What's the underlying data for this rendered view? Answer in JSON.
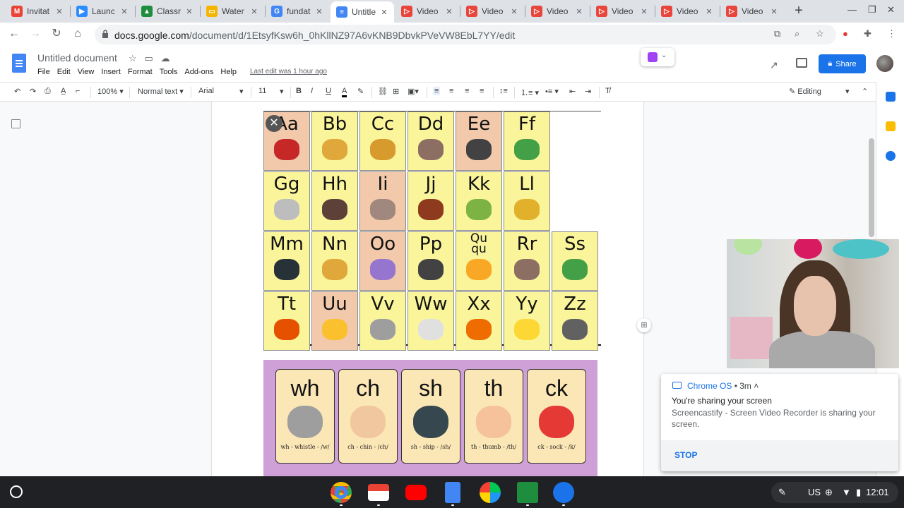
{
  "tabs": [
    {
      "label": "Invitat",
      "icon": "gmail-icon",
      "color": "#ea4335",
      "glyph": "M"
    },
    {
      "label": "Launc",
      "icon": "zoom-icon",
      "color": "#2d8cff",
      "glyph": "▶"
    },
    {
      "label": "Classr",
      "icon": "classroom-icon",
      "color": "#1e8e3e",
      "glyph": "▲"
    },
    {
      "label": "Water",
      "icon": "slides-icon",
      "color": "#f4b400",
      "glyph": "▭"
    },
    {
      "label": "fundat",
      "icon": "google-icon",
      "color": "#4285f4",
      "glyph": "G"
    },
    {
      "label": "Untitle",
      "icon": "docs-icon",
      "color": "#4285f4",
      "glyph": "≡"
    },
    {
      "label": "Video",
      "icon": "screencastify-icon",
      "color": "#e8453c",
      "glyph": "▷"
    },
    {
      "label": "Video",
      "icon": "screencastify-icon",
      "color": "#e8453c",
      "glyph": "▷"
    },
    {
      "label": "Video",
      "icon": "screencastify-icon",
      "color": "#e8453c",
      "glyph": "▷"
    },
    {
      "label": "Video",
      "icon": "screencastify-icon",
      "color": "#e8453c",
      "glyph": "▷"
    },
    {
      "label": "Video",
      "icon": "screencastify-icon",
      "color": "#e8453c",
      "glyph": "▷"
    },
    {
      "label": "Video",
      "icon": "screencastify-icon",
      "color": "#e8453c",
      "glyph": "▷"
    }
  ],
  "omnibox": {
    "domain": "docs.google.com",
    "path": "/document/d/1EtsyfKsw6h_0hKllNZ97A6vKNB9DbvkPVeVW8EbL7YY/edit"
  },
  "doc": {
    "title": "Untitled document",
    "menu": [
      "File",
      "Edit",
      "View",
      "Insert",
      "Format",
      "Tools",
      "Add-ons",
      "Help"
    ],
    "last_edit": "Last edit was 1 hour ago",
    "share_label": "Share"
  },
  "format_bar": {
    "zoom": "100%",
    "style": "Normal text",
    "font": "Arial",
    "size": "11",
    "mode": "Editing"
  },
  "alphabet_chart": [
    {
      "letter": "Aa",
      "color": "#f3c9ab",
      "pic": "#c62828"
    },
    {
      "letter": "Bb",
      "color": "#faf59a",
      "pic": "#e0a83a"
    },
    {
      "letter": "Cc",
      "color": "#faf59a",
      "pic": "#d79a2c"
    },
    {
      "letter": "Dd",
      "color": "#faf59a",
      "pic": "#8d6e63"
    },
    {
      "letter": "Ee",
      "color": "#f3c9ab",
      "pic": "#424242"
    },
    {
      "letter": "Ff",
      "color": "#faf59a",
      "pic": "#43a047"
    },
    {
      "letter": "Gg",
      "color": "#faf59a",
      "pic": "#bdbdbd"
    },
    {
      "letter": "Hh",
      "color": "#faf59a",
      "pic": "#5d4037"
    },
    {
      "letter": "Ii",
      "color": "#f3c9ab",
      "pic": "#a1887f"
    },
    {
      "letter": "Jj",
      "color": "#faf59a",
      "pic": "#8d3a1f"
    },
    {
      "letter": "Kk",
      "color": "#faf59a",
      "pic": "#7cb342"
    },
    {
      "letter": "Ll",
      "color": "#faf59a",
      "pic": "#e1b12c"
    },
    {
      "letter": "Mm",
      "color": "#faf59a",
      "pic": "#263238"
    },
    {
      "letter": "Nn",
      "color": "#faf59a",
      "pic": "#e0a83a"
    },
    {
      "letter": "Oo",
      "color": "#f3c9ab",
      "pic": "#9575cd"
    },
    {
      "letter": "Pp",
      "color": "#faf59a",
      "pic": "#424242"
    },
    {
      "letter": "Qu qu",
      "color": "#faf59a",
      "pic": "#f9a825"
    },
    {
      "letter": "Rr",
      "color": "#faf59a",
      "pic": "#8d6e63"
    },
    {
      "letter": "Ss",
      "color": "#faf59a",
      "pic": "#43a047"
    },
    {
      "letter": "Tt",
      "color": "#faf59a",
      "pic": "#e65100"
    },
    {
      "letter": "Uu",
      "color": "#f3c9ab",
      "pic": "#fbc02d"
    },
    {
      "letter": "Vv",
      "color": "#faf59a",
      "pic": "#9e9e9e"
    },
    {
      "letter": "Ww",
      "color": "#faf59a",
      "pic": "#e0e0e0"
    },
    {
      "letter": "Xx",
      "color": "#faf59a",
      "pic": "#ef6c00"
    },
    {
      "letter": "Yy",
      "color": "#faf59a",
      "pic": "#fdd835"
    },
    {
      "letter": "Zz",
      "color": "#faf59a",
      "pic": "#616161"
    }
  ],
  "digraphs": [
    {
      "text": "wh",
      "caption": "wh - whistle - /w/",
      "pic": "#9e9e9e"
    },
    {
      "text": "ch",
      "caption": "ch - chin - /ch/",
      "pic": "#f1c7a0"
    },
    {
      "text": "sh",
      "caption": "sh - ship - /sh/",
      "pic": "#37474f"
    },
    {
      "text": "th",
      "caption": "th - thumb - /th/",
      "pic": "#f5c29b"
    },
    {
      "text": "ck",
      "caption": "ck - sock - /k/",
      "pic": "#e53935"
    }
  ],
  "notification": {
    "source": "Chrome OS",
    "age": "• 3m ˄",
    "title": "You're sharing your screen",
    "message": "Screencastify - Screen Video Recorder is sharing your screen.",
    "action": "STOP"
  },
  "tray": {
    "locale": "US",
    "time": "12:01"
  }
}
